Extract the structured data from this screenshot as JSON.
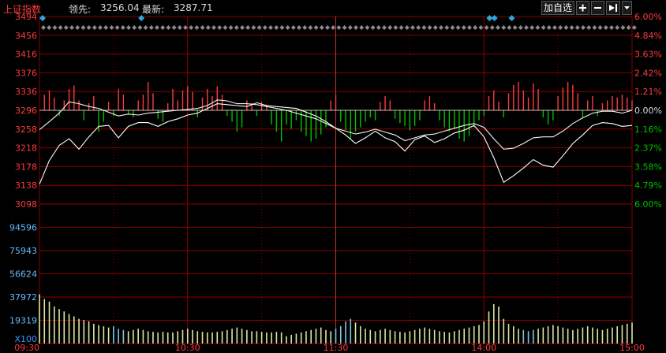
{
  "header": {
    "title": "上证指数",
    "leading_label": "领先:",
    "leading_value": "3256.04",
    "latest_label": "最新:",
    "latest_value": "3287.71"
  },
  "toolbar": {
    "add_label": "加自选",
    "plus_icon": "plus-icon",
    "minus_icon": "minus-icon",
    "push_icon": "arrow-right-bar-icon",
    "menu_icon": "dropdown-triangle-icon"
  },
  "colors": {
    "up": "#ff3b3b",
    "down": "#00c000",
    "grid": "#8b0000",
    "price_line": "#ffffff",
    "avg_line": "#ffff00",
    "volume": "#dfe6a0",
    "volume_alt": "#7ec8e3",
    "event_marker": "#2aa8e0",
    "axis_text": "#ff3b3b"
  },
  "chart_data": {
    "type": "line",
    "price_axis": {
      "labels": [
        "3494",
        "3456",
        "3416",
        "3376",
        "3336",
        "3296",
        "3258",
        "3218",
        "3178",
        "3138",
        "3098"
      ],
      "prev_close": 3296,
      "range": [
        3098,
        3494
      ]
    },
    "percent_axis": {
      "labels": [
        "6.00%",
        "4.84%",
        "3.63%",
        "2.42%",
        "1.21%",
        "0.00%",
        "1.16%",
        "2.37%",
        "3.58%",
        "4.79%",
        "6.00%"
      ]
    },
    "volume_axis": {
      "labels": [
        "94596",
        "75943",
        "56624",
        "37972",
        "19319",
        "X100"
      ],
      "max": 113000
    },
    "time_axis": {
      "labels": [
        "09:30",
        "10:30",
        "11:30",
        "14:00",
        "15:00"
      ]
    },
    "series": [
      {
        "name": "",
        "x": [
          0,
          4,
          8,
          12,
          16,
          20,
          24,
          28,
          32,
          36,
          40,
          44,
          48,
          52,
          56,
          60,
          64,
          68,
          72,
          76,
          80,
          84,
          88,
          92,
          96,
          100,
          104,
          108,
          112,
          116,
          120,
          124,
          128,
          132,
          136,
          140,
          144,
          148,
          152,
          156,
          160,
          164,
          168,
          172,
          176,
          180,
          184,
          188,
          192,
          196,
          200,
          204,
          208,
          212,
          216,
          220,
          224,
          228,
          232,
          236,
          240
        ],
        "y": [
          3140,
          3190,
          3222,
          3236,
          3214,
          3240,
          3262,
          3264,
          3238,
          3262,
          3270,
          3270,
          3262,
          3272,
          3278,
          3286,
          3290,
          3300,
          3310,
          3308,
          3306,
          3304,
          3312,
          3306,
          3304,
          3302,
          3300,
          3292,
          3284,
          3272,
          3258,
          3244,
          3226,
          3238,
          3252,
          3238,
          3230,
          3210,
          3234,
          3242,
          3228,
          3236,
          3248,
          3254,
          3264,
          3240,
          3196,
          3144,
          3158,
          3174,
          3192,
          3180,
          3176,
          3200,
          3226,
          3244,
          3264,
          3270,
          3268,
          3262,
          3264
        ]
      },
      {
        "name": "",
        "x": [
          0,
          4,
          8,
          12,
          16,
          20,
          24,
          28,
          32,
          36,
          40,
          44,
          48,
          52,
          56,
          60,
          64,
          68,
          72,
          76,
          80,
          84,
          88,
          92,
          96,
          100,
          104,
          108,
          112,
          116,
          120,
          124,
          128,
          132,
          136,
          140,
          144,
          148,
          152,
          156,
          160,
          164,
          168,
          172,
          176,
          180,
          184,
          188,
          192,
          196,
          200,
          204,
          208,
          212,
          216,
          220,
          224,
          228,
          232,
          236,
          240
        ],
        "y": [
          3255,
          3272,
          3290,
          3314,
          3310,
          3304,
          3300,
          3292,
          3284,
          3288,
          3286,
          3290,
          3292,
          3294,
          3296,
          3298,
          3300,
          3306,
          3318,
          3316,
          3310,
          3310,
          3308,
          3304,
          3300,
          3296,
          3290,
          3284,
          3278,
          3268,
          3258,
          3252,
          3246,
          3250,
          3256,
          3250,
          3244,
          3232,
          3238,
          3244,
          3246,
          3252,
          3258,
          3264,
          3268,
          3260,
          3236,
          3214,
          3216,
          3226,
          3238,
          3240,
          3240,
          3252,
          3268,
          3280,
          3290,
          3294,
          3294,
          3290,
          3296
        ]
      }
    ],
    "macd_bars": [
      {
        "x": 2,
        "v": 22
      },
      {
        "x": 4,
        "v": 28
      },
      {
        "x": 6,
        "v": 18
      },
      {
        "x": 8,
        "v": -8
      },
      {
        "x": 10,
        "v": 14
      },
      {
        "x": 12,
        "v": 30
      },
      {
        "x": 14,
        "v": 35
      },
      {
        "x": 16,
        "v": 14
      },
      {
        "x": 18,
        "v": -14
      },
      {
        "x": 20,
        "v": 10
      },
      {
        "x": 22,
        "v": 20
      },
      {
        "x": 24,
        "v": -30
      },
      {
        "x": 26,
        "v": -16
      },
      {
        "x": 28,
        "v": 12
      },
      {
        "x": 30,
        "v": -8
      },
      {
        "x": 32,
        "v": 30
      },
      {
        "x": 34,
        "v": 22
      },
      {
        "x": 36,
        "v": -6
      },
      {
        "x": 38,
        "v": -10
      },
      {
        "x": 40,
        "v": 14
      },
      {
        "x": 42,
        "v": 22
      },
      {
        "x": 44,
        "v": 40
      },
      {
        "x": 46,
        "v": 24
      },
      {
        "x": 48,
        "v": -12
      },
      {
        "x": 50,
        "v": -16
      },
      {
        "x": 52,
        "v": 10
      },
      {
        "x": 54,
        "v": 30
      },
      {
        "x": 56,
        "v": 14
      },
      {
        "x": 58,
        "v": 28
      },
      {
        "x": 60,
        "v": 34
      },
      {
        "x": 62,
        "v": 26
      },
      {
        "x": 64,
        "v": -10
      },
      {
        "x": 66,
        "v": 18
      },
      {
        "x": 68,
        "v": 30
      },
      {
        "x": 70,
        "v": 20
      },
      {
        "x": 72,
        "v": 34
      },
      {
        "x": 74,
        "v": 22
      },
      {
        "x": 76,
        "v": -8
      },
      {
        "x": 78,
        "v": -16
      },
      {
        "x": 80,
        "v": -30
      },
      {
        "x": 82,
        "v": -24
      },
      {
        "x": 84,
        "v": 14
      },
      {
        "x": 86,
        "v": 10
      },
      {
        "x": 88,
        "v": -8
      },
      {
        "x": 90,
        "v": 12
      },
      {
        "x": 92,
        "v": 8
      },
      {
        "x": 94,
        "v": -20
      },
      {
        "x": 96,
        "v": -30
      },
      {
        "x": 98,
        "v": -44
      },
      {
        "x": 100,
        "v": -20
      },
      {
        "x": 102,
        "v": -26
      },
      {
        "x": 104,
        "v": -14
      },
      {
        "x": 106,
        "v": -30
      },
      {
        "x": 108,
        "v": -36
      },
      {
        "x": 110,
        "v": -44
      },
      {
        "x": 112,
        "v": -40
      },
      {
        "x": 114,
        "v": -34
      },
      {
        "x": 116,
        "v": -24
      },
      {
        "x": 118,
        "v": 14
      },
      {
        "x": 120,
        "v": 22
      },
      {
        "x": 122,
        "v": -16
      },
      {
        "x": 124,
        "v": -28
      },
      {
        "x": 126,
        "v": -40
      },
      {
        "x": 128,
        "v": -30
      },
      {
        "x": 130,
        "v": -24
      },
      {
        "x": 132,
        "v": -16
      },
      {
        "x": 134,
        "v": -10
      },
      {
        "x": 136,
        "v": -14
      },
      {
        "x": 138,
        "v": 12
      },
      {
        "x": 140,
        "v": 20
      },
      {
        "x": 142,
        "v": 14
      },
      {
        "x": 144,
        "v": -12
      },
      {
        "x": 146,
        "v": -18
      },
      {
        "x": 148,
        "v": -22
      },
      {
        "x": 150,
        "v": -28
      },
      {
        "x": 152,
        "v": -22
      },
      {
        "x": 154,
        "v": -14
      },
      {
        "x": 156,
        "v": 14
      },
      {
        "x": 158,
        "v": 20
      },
      {
        "x": 160,
        "v": 10
      },
      {
        "x": 162,
        "v": -14
      },
      {
        "x": 164,
        "v": -24
      },
      {
        "x": 166,
        "v": -30
      },
      {
        "x": 168,
        "v": -26
      },
      {
        "x": 170,
        "v": -40
      },
      {
        "x": 172,
        "v": -44
      },
      {
        "x": 174,
        "v": -36
      },
      {
        "x": 176,
        "v": -24
      },
      {
        "x": 178,
        "v": -14
      },
      {
        "x": 180,
        "v": -8
      },
      {
        "x": 182,
        "v": 20
      },
      {
        "x": 184,
        "v": 28
      },
      {
        "x": 186,
        "v": 12
      },
      {
        "x": 188,
        "v": -10
      },
      {
        "x": 190,
        "v": 24
      },
      {
        "x": 192,
        "v": 36
      },
      {
        "x": 194,
        "v": 40
      },
      {
        "x": 196,
        "v": 28
      },
      {
        "x": 198,
        "v": 18
      },
      {
        "x": 200,
        "v": 38
      },
      {
        "x": 202,
        "v": 30
      },
      {
        "x": 204,
        "v": -10
      },
      {
        "x": 206,
        "v": -20
      },
      {
        "x": 208,
        "v": -14
      },
      {
        "x": 210,
        "v": 20
      },
      {
        "x": 212,
        "v": 32
      },
      {
        "x": 214,
        "v": 40
      },
      {
        "x": 216,
        "v": 36
      },
      {
        "x": 218,
        "v": 24
      },
      {
        "x": 220,
        "v": -10
      },
      {
        "x": 222,
        "v": 14
      },
      {
        "x": 224,
        "v": 20
      },
      {
        "x": 226,
        "v": -8
      },
      {
        "x": 228,
        "v": 10
      },
      {
        "x": 230,
        "v": 14
      },
      {
        "x": 232,
        "v": 20
      },
      {
        "x": 234,
        "v": 18
      },
      {
        "x": 236,
        "v": 22
      },
      {
        "x": 238,
        "v": 18
      },
      {
        "x": 240,
        "v": 14
      }
    ],
    "volume": {
      "x": [
        0,
        2,
        4,
        6,
        8,
        10,
        12,
        14,
        16,
        18,
        20,
        22,
        24,
        26,
        28,
        30,
        32,
        34,
        36,
        38,
        40,
        42,
        44,
        46,
        48,
        50,
        52,
        54,
        56,
        58,
        60,
        62,
        64,
        66,
        68,
        70,
        72,
        74,
        76,
        78,
        80,
        82,
        84,
        86,
        88,
        90,
        92,
        94,
        96,
        98,
        100,
        102,
        104,
        106,
        108,
        110,
        112,
        114,
        116,
        118,
        120,
        122,
        124,
        126,
        128,
        130,
        132,
        134,
        136,
        138,
        140,
        142,
        144,
        146,
        148,
        150,
        152,
        154,
        156,
        158,
        160,
        162,
        164,
        166,
        168,
        170,
        172,
        174,
        176,
        178,
        180,
        182,
        184,
        186,
        188,
        190,
        192,
        194,
        196,
        198,
        200,
        202,
        204,
        206,
        208,
        210,
        212,
        214,
        216,
        218,
        220,
        222,
        224,
        226,
        228,
        230,
        232,
        234,
        236,
        238,
        240
      ],
      "values": [
        40000,
        36000,
        34000,
        30000,
        28000,
        26000,
        24000,
        22000,
        20000,
        19000,
        18000,
        16000,
        15000,
        14000,
        13000,
        14000,
        12000,
        11000,
        10000,
        11000,
        12000,
        11000,
        10000,
        9500,
        9000,
        9500,
        9000,
        9000,
        10000,
        11000,
        12000,
        11000,
        10000,
        9500,
        9000,
        9000,
        9500,
        10000,
        11000,
        12000,
        13000,
        12000,
        11000,
        10000,
        10000,
        9500,
        9000,
        9000,
        9500,
        9000,
        6000,
        7000,
        8000,
        9000,
        10000,
        11000,
        12000,
        13000,
        11000,
        10000,
        12000,
        14000,
        18000,
        20000,
        17000,
        14000,
        12000,
        11000,
        10000,
        11000,
        12000,
        11000,
        10000,
        9500,
        9000,
        10000,
        11000,
        12000,
        13000,
        12000,
        11000,
        10000,
        9500,
        9000,
        10000,
        11000,
        12000,
        13000,
        14000,
        15000,
        18000,
        26000,
        32000,
        30000,
        20000,
        16000,
        14000,
        12000,
        11000,
        10000,
        11000,
        12000,
        13000,
        14000,
        15000,
        14000,
        13000,
        12000,
        11000,
        12000,
        13000,
        14000,
        13000,
        12000,
        11000,
        12000,
        13000,
        14000,
        15000,
        16000,
        17000
      ]
    },
    "event_markers_x": [
      0,
      40,
      181,
      183,
      190,
      265
    ],
    "grid": true
  }
}
